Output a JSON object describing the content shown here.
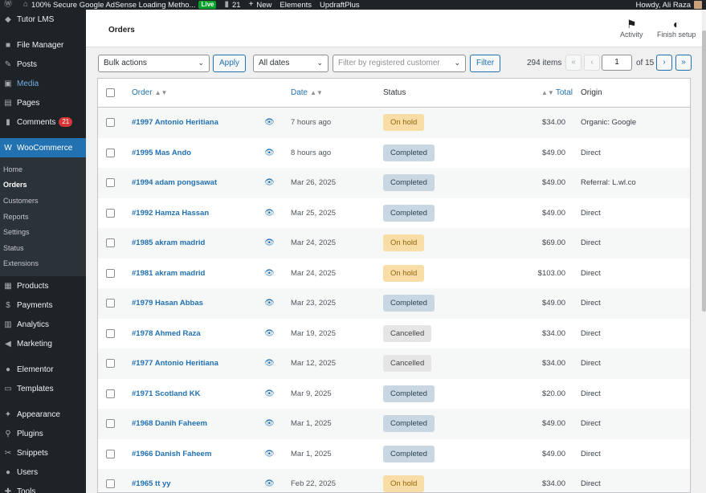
{
  "adminbar": {
    "site_name": "100% Secure Google AdSense Loading Metho...",
    "live_badge": "Live",
    "comments_count": "21",
    "new_label": "New",
    "elements_label": "Elements",
    "updraft_label": "UpdraftPlus",
    "howdy": "Howdy, Ali Raza"
  },
  "sidebar": {
    "items_top": [
      {
        "label": "Tutor LMS",
        "icon": "graduation-cap-icon"
      },
      {
        "label": "File Manager",
        "icon": "folder-icon"
      },
      {
        "label": "Posts",
        "icon": "pin-icon"
      },
      {
        "label": "Media",
        "icon": "media-icon"
      },
      {
        "label": "Pages",
        "icon": "pages-icon"
      },
      {
        "label": "Comments",
        "icon": "comment-icon",
        "badge": "21"
      },
      {
        "label": "WooCommerce",
        "icon": "woo-icon"
      }
    ],
    "submenu": [
      "Home",
      "Orders",
      "Customers",
      "Reports",
      "Settings",
      "Status",
      "Extensions"
    ],
    "items_bottom": [
      {
        "label": "Products",
        "icon": "products-icon"
      },
      {
        "label": "Payments",
        "icon": "payments-icon"
      },
      {
        "label": "Analytics",
        "icon": "analytics-icon"
      },
      {
        "label": "Marketing",
        "icon": "marketing-icon"
      },
      {
        "label": "Elementor",
        "icon": "elementor-icon"
      },
      {
        "label": "Templates",
        "icon": "templates-icon"
      },
      {
        "label": "Appearance",
        "icon": "appearance-icon"
      },
      {
        "label": "Plugins",
        "icon": "plugins-icon"
      },
      {
        "label": "Snippets",
        "icon": "snippets-icon"
      },
      {
        "label": "Users",
        "icon": "users-icon"
      },
      {
        "label": "Tools",
        "icon": "tools-icon"
      }
    ]
  },
  "header": {
    "title": "Orders",
    "activity_label": "Activity",
    "finish_setup_label": "Finish setup"
  },
  "filters": {
    "bulk_actions": "Bulk actions",
    "apply": "Apply",
    "all_dates": "All dates",
    "customer_placeholder": "Filter by registered customer",
    "filter": "Filter",
    "items_count": "294 items",
    "current_page": "1",
    "of_pages": "of 15"
  },
  "table": {
    "columns": {
      "order": "Order",
      "date": "Date",
      "status": "Status",
      "total": "Total",
      "origin": "Origin"
    },
    "rows": [
      {
        "order": "#1997 Antonio Heritiana",
        "date": "7 hours ago",
        "status": "On hold",
        "total": "$34.00",
        "origin": "Organic: Google"
      },
      {
        "order": "#1995 Mas Ando",
        "date": "8 hours ago",
        "status": "Completed",
        "total": "$49.00",
        "origin": "Direct"
      },
      {
        "order": "#1994 adam pongsawat",
        "date": "Mar 26, 2025",
        "status": "Completed",
        "total": "$49.00",
        "origin": "Referral: L.wl.co"
      },
      {
        "order": "#1992 Hamza Hassan",
        "date": "Mar 25, 2025",
        "status": "Completed",
        "total": "$49.00",
        "origin": "Direct"
      },
      {
        "order": "#1985 akram madrid",
        "date": "Mar 24, 2025",
        "status": "On hold",
        "total": "$69.00",
        "origin": "Direct"
      },
      {
        "order": "#1981 akram madrid",
        "date": "Mar 24, 2025",
        "status": "On hold",
        "total": "$103.00",
        "origin": "Direct"
      },
      {
        "order": "#1979 Hasan Abbas",
        "date": "Mar 23, 2025",
        "status": "Completed",
        "total": "$49.00",
        "origin": "Direct"
      },
      {
        "order": "#1978 Ahmed Raza",
        "date": "Mar 19, 2025",
        "status": "Cancelled",
        "total": "$34.00",
        "origin": "Direct"
      },
      {
        "order": "#1977 Antonio Heritiana",
        "date": "Mar 12, 2025",
        "status": "Cancelled",
        "total": "$34.00",
        "origin": "Direct"
      },
      {
        "order": "#1971 Scotland KK",
        "date": "Mar 9, 2025",
        "status": "Completed",
        "total": "$20.00",
        "origin": "Direct"
      },
      {
        "order": "#1968 Danih Faheem",
        "date": "Mar 1, 2025",
        "status": "Completed",
        "total": "$49.00",
        "origin": "Direct"
      },
      {
        "order": "#1966 Danish Faheem",
        "date": "Mar 1, 2025",
        "status": "Completed",
        "total": "$49.00",
        "origin": "Direct"
      },
      {
        "order": "#1965 tt yy",
        "date": "Feb 22, 2025",
        "status": "On hold",
        "total": "$34.00",
        "origin": "Direct"
      }
    ]
  },
  "colors": {
    "accent": "#2271b1",
    "sidebar_bg": "#1d2327",
    "on_hold_bg": "#f8dda7",
    "completed_bg": "#c8d7e1",
    "cancelled_bg": "#e5e5e5"
  }
}
